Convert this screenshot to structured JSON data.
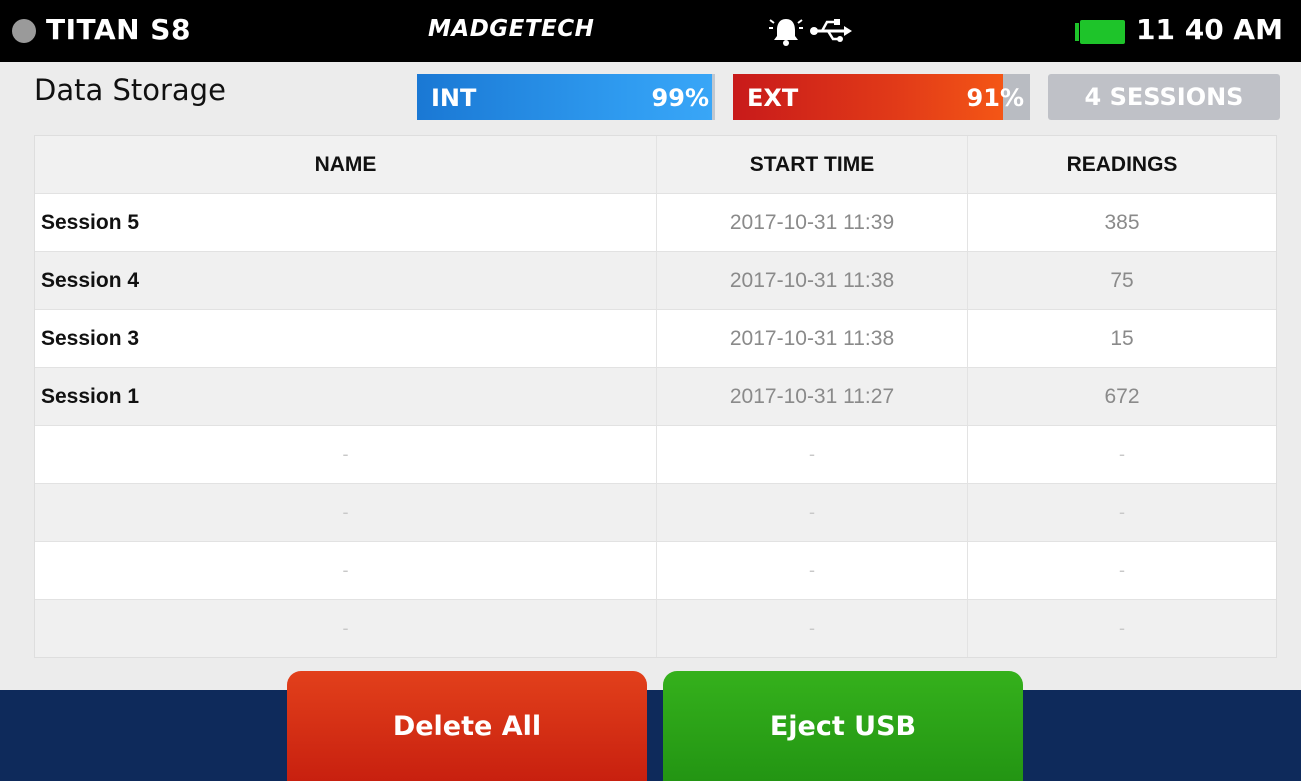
{
  "status_bar": {
    "device_name": "TITAN S8",
    "brand": "MADGETECH",
    "time": "11 40 AM",
    "icons": [
      "status-dot",
      "alarm-icon",
      "usb-icon",
      "battery-icon"
    ],
    "battery_color": "#1ec42a"
  },
  "page": {
    "title": "Data Storage"
  },
  "storage": {
    "internal": {
      "label": "INT",
      "percent_text": "99%",
      "used_fraction": 0.99,
      "color": "#2a90e8"
    },
    "external": {
      "label": "EXT",
      "percent_text": "91%",
      "used_fraction": 0.91,
      "color": "#e03218"
    },
    "sessions_badge": "4 SESSIONS"
  },
  "table": {
    "headers": {
      "name": "NAME",
      "start_time": "START TIME",
      "readings": "READINGS"
    },
    "rows": [
      {
        "name": "Session 5",
        "start_time": "2017-10-31 11:39",
        "readings": "385"
      },
      {
        "name": "Session 4",
        "start_time": "2017-10-31 11:38",
        "readings": "75"
      },
      {
        "name": "Session 3",
        "start_time": "2017-10-31 11:38",
        "readings": "15"
      },
      {
        "name": "Session 1",
        "start_time": "2017-10-31 11:27",
        "readings": "672"
      }
    ],
    "empty_placeholder": "-"
  },
  "actions": {
    "delete_all": "Delete All",
    "eject_usb": "Eject USB",
    "delete_color": "#d62d13",
    "eject_color": "#2da518",
    "footer_color": "#0e2a5b"
  }
}
